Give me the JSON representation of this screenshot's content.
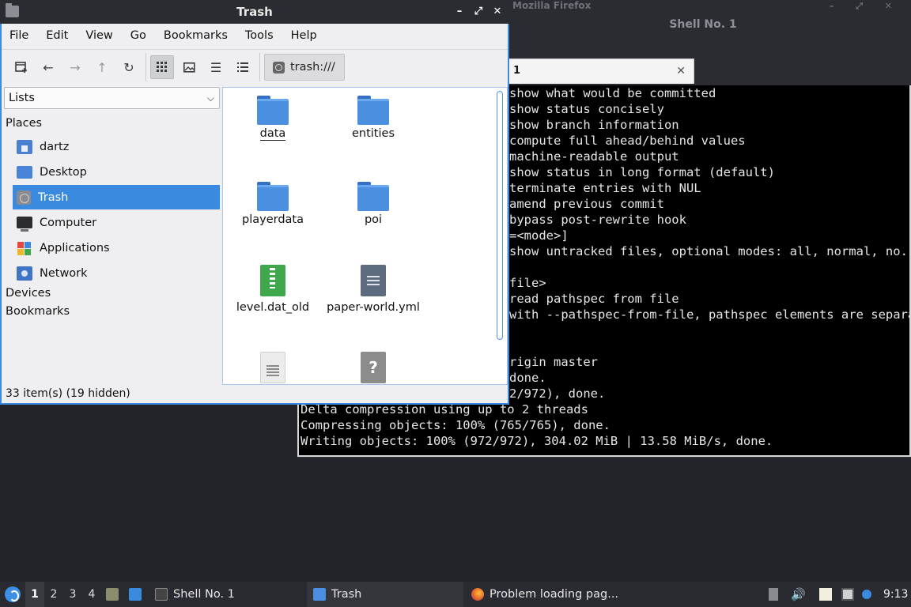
{
  "background": {
    "firefox_title": "Mozilla Firefox",
    "terminal_title": "Shell No. 1",
    "terminal_tab_label": "1",
    "terminal_lines": [
      "show what would be committed",
      "show status concisely",
      "show branch information",
      "compute full ahead/behind values",
      "machine-readable output",
      "show status in long format (default)",
      "terminate entries with NUL",
      "amend previous commit",
      "bypass post-rewrite hook",
      "=<mode>]",
      "show untracked files, optional modes: all, normal, no.",
      "",
      "file>",
      "read pathspec from file",
      "with --pathspec-from-file, pathspec elements are separated with NUL character",
      "",
      "",
      "rigin master",
      "done.",
      "2/972), done.",
      "Delta compression using up to 2 threads",
      "Compressing objects: 100% (765/765), done.",
      "Writing objects: 100% (972/972), 304.02 MiB | 13.58 MiB/s, done."
    ]
  },
  "file_manager": {
    "title": "Trash",
    "menu": [
      "File",
      "Edit",
      "View",
      "Go",
      "Bookmarks",
      "Tools",
      "Help"
    ],
    "path": "trash:///",
    "side_select": "Lists",
    "places_heading": "Places",
    "places": [
      {
        "label": "dartz",
        "icon": "home-folder-icon"
      },
      {
        "label": "Desktop",
        "icon": "desktop-icon"
      },
      {
        "label": "Trash",
        "icon": "trash-icon"
      },
      {
        "label": "Computer",
        "icon": "computer-icon"
      },
      {
        "label": "Applications",
        "icon": "applications-icon"
      },
      {
        "label": "Network",
        "icon": "network-icon"
      }
    ],
    "devices_heading": "Devices",
    "bookmarks_heading": "Bookmarks",
    "files": [
      {
        "name": "data",
        "icon": "folder-icon"
      },
      {
        "name": "entities",
        "icon": "folder-icon"
      },
      {
        "name": "playerdata",
        "icon": "folder-icon"
      },
      {
        "name": "poi",
        "icon": "folder-icon"
      },
      {
        "name": "level.dat_old",
        "icon": "archive-file-icon"
      },
      {
        "name": "paper-world.yml",
        "icon": "text-file-icon"
      },
      {
        "name": "",
        "icon": "plain-document-icon"
      },
      {
        "name": "",
        "icon": "unknown-file-icon"
      }
    ],
    "status": "33 item(s) (19 hidden)"
  },
  "taskbar": {
    "workspaces": [
      "1",
      "2",
      "3",
      "4"
    ],
    "tasks": [
      {
        "label": "Shell No. 1",
        "icon": "terminal-icon"
      },
      {
        "label": "Trash",
        "icon": "folder-icon"
      },
      {
        "label": "Problem loading pag...",
        "icon": "firefox-icon"
      }
    ],
    "clock": "9:13"
  },
  "colors": {
    "accent": "#3a8be0",
    "panel": "#2a2b30",
    "folder": "#4a8fe0"
  }
}
